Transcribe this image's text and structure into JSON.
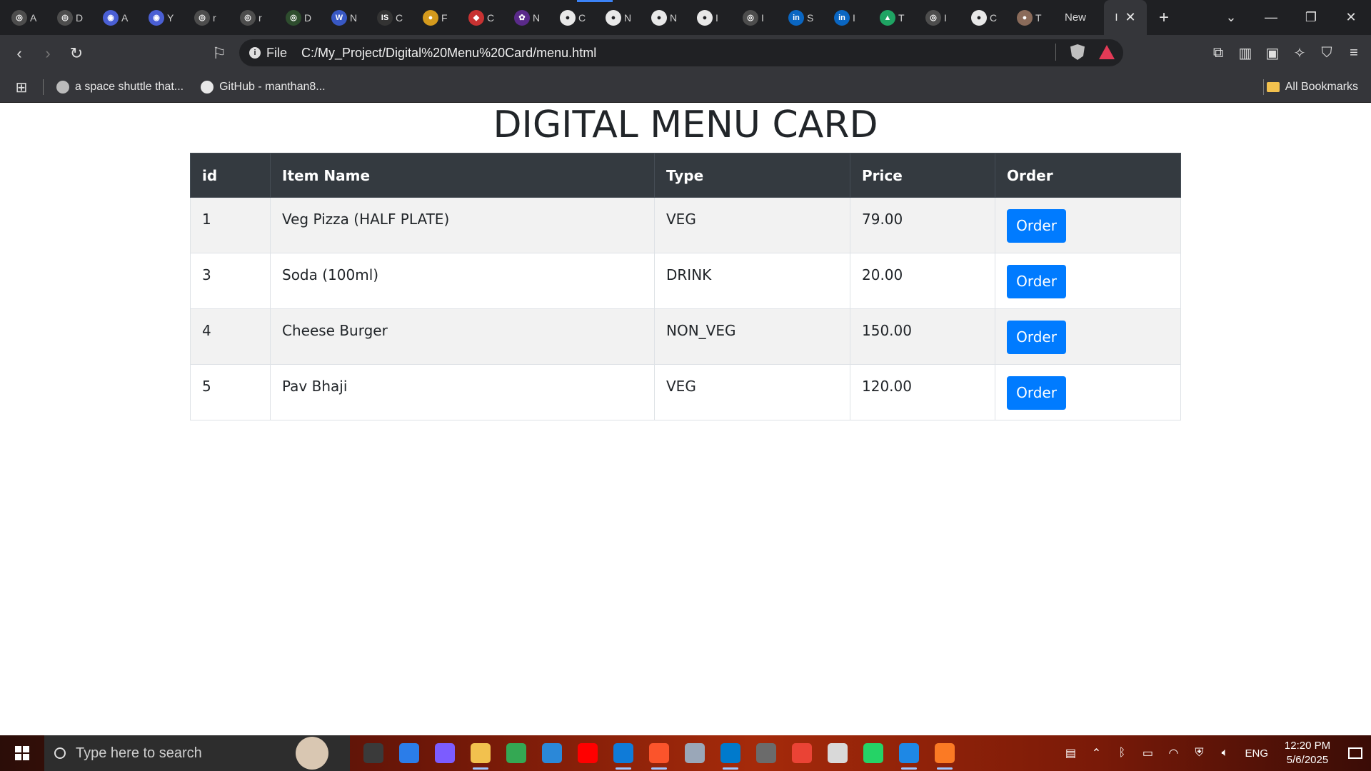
{
  "browser": {
    "tabs": [
      {
        "icon": "openai-icon",
        "color": "#4d4d4d",
        "glyph": "◎",
        "label": "A"
      },
      {
        "icon": "openai-icon",
        "color": "#4d4d4d",
        "glyph": "◎",
        "label": "D"
      },
      {
        "icon": "gemini-icon",
        "color": "#4a5fd4",
        "glyph": "◉",
        "label": "A"
      },
      {
        "icon": "gemini-icon",
        "color": "#4a5fd4",
        "glyph": "◉",
        "label": "Y"
      },
      {
        "icon": "openai-icon",
        "color": "#4d4d4d",
        "glyph": "◎",
        "label": "r"
      },
      {
        "icon": "openai-icon",
        "color": "#4d4d4d",
        "glyph": "◎",
        "label": "r"
      },
      {
        "icon": "circle-icon",
        "color": "#2e4d2e",
        "glyph": "◎",
        "label": "D"
      },
      {
        "icon": "wordpress-icon",
        "color": "#3858c4",
        "glyph": "W",
        "label": "N"
      },
      {
        "icon": "is-icon",
        "color": "#333333",
        "glyph": "IS",
        "label": "C"
      },
      {
        "icon": "coin-icon",
        "color": "#d49a1d",
        "glyph": "●",
        "label": "F"
      },
      {
        "icon": "shield-icon",
        "color": "#c83232",
        "glyph": "◆",
        "label": "C"
      },
      {
        "icon": "flower-icon",
        "color": "#5a2a8a",
        "glyph": "✿",
        "label": "N"
      },
      {
        "icon": "github-icon",
        "color": "#e8e8e8",
        "glyph": "●",
        "label": "C"
      },
      {
        "icon": "github-icon",
        "color": "#e8e8e8",
        "glyph": "●",
        "label": "N"
      },
      {
        "icon": "github-icon",
        "color": "#e8e8e8",
        "glyph": "●",
        "label": "N"
      },
      {
        "icon": "github-icon",
        "color": "#e8e8e8",
        "glyph": "●",
        "label": "I"
      },
      {
        "icon": "openai-icon",
        "color": "#4d4d4d",
        "glyph": "◎",
        "label": "I"
      },
      {
        "icon": "linkedin-icon",
        "color": "#0a66c2",
        "glyph": "in",
        "label": "S"
      },
      {
        "icon": "linkedin-icon",
        "color": "#0a66c2",
        "glyph": "in",
        "label": "I"
      },
      {
        "icon": "drive-icon",
        "color": "#1fa463",
        "glyph": "▲",
        "label": "T"
      },
      {
        "icon": "openai-icon",
        "color": "#4d4d4d",
        "glyph": "◎",
        "label": "I"
      },
      {
        "icon": "github-icon",
        "color": "#e8e8e8",
        "glyph": "●",
        "label": "C"
      },
      {
        "icon": "avatar-icon",
        "color": "#8a6b5a",
        "glyph": "●",
        "label": "T"
      }
    ],
    "text_tab_label": "New",
    "active_tab_label": "I",
    "address_prefix": "File",
    "address_url": "C:/My_Project/Digital%20Menu%20Card/menu.html",
    "bookmarks": [
      {
        "label": "a space shuttle that...",
        "icon": "globe-icon"
      },
      {
        "label": "GitHub - manthan8...",
        "icon": "github-icon"
      }
    ],
    "all_bookmarks_label": "All Bookmarks"
  },
  "page": {
    "title": "DIGITAL MENU CARD",
    "columns": [
      "id",
      "Item Name",
      "Type",
      "Price",
      "Order"
    ],
    "rows": [
      {
        "id": "1",
        "name": "Veg Pizza (HALF PLATE)",
        "type": "VEG",
        "price": "79.00",
        "action": "Order"
      },
      {
        "id": "3",
        "name": "Soda (100ml)",
        "type": "DRINK",
        "price": "20.00",
        "action": "Order"
      },
      {
        "id": "4",
        "name": "Cheese Burger",
        "type": "NON_VEG",
        "price": "150.00",
        "action": "Order"
      },
      {
        "id": "5",
        "name": "Pav Bhaji",
        "type": "VEG",
        "price": "120.00",
        "action": "Order"
      }
    ],
    "colors": {
      "header_bg": "#343a40",
      "button_bg": "#007bff",
      "stripe": "#f2f2f2"
    }
  },
  "taskbar": {
    "search_placeholder": "Type here to search",
    "apps": [
      {
        "icon": "task-view-icon",
        "color": "#3a3a3a",
        "running": false
      },
      {
        "icon": "store-icon",
        "color": "#2b7de9",
        "running": false
      },
      {
        "icon": "copilot-icon",
        "color": "#7c5cff",
        "running": false
      },
      {
        "icon": "file-explorer-icon",
        "color": "#f2c14e",
        "running": true
      },
      {
        "icon": "chrome-icon",
        "color": "#34a853",
        "running": false
      },
      {
        "icon": "news-icon",
        "color": "#2b88d8",
        "running": false
      },
      {
        "icon": "youtube-icon",
        "color": "#ff0000",
        "running": false
      },
      {
        "icon": "edge-icon",
        "color": "#0f7bd8",
        "running": true
      },
      {
        "icon": "brave-icon",
        "color": "#fb542b",
        "running": true
      },
      {
        "icon": "photos-icon",
        "color": "#9aa7b8",
        "running": false
      },
      {
        "icon": "vscode-icon",
        "color": "#007acc",
        "running": true
      },
      {
        "icon": "settings-icon",
        "color": "#6b6b6b",
        "running": false
      },
      {
        "icon": "gmail-icon",
        "color": "#ea4335",
        "running": false
      },
      {
        "icon": "news-app-icon",
        "color": "#d9d9d9",
        "running": false
      },
      {
        "icon": "whatsapp-icon",
        "color": "#25d366",
        "running": false
      },
      {
        "icon": "browser-icon",
        "color": "#1e88e5",
        "running": true
      },
      {
        "icon": "xampp-icon",
        "color": "#fb7a24",
        "running": true
      }
    ],
    "tray_language": "ENG",
    "time": "12:20 PM",
    "date": "5/6/2025"
  }
}
